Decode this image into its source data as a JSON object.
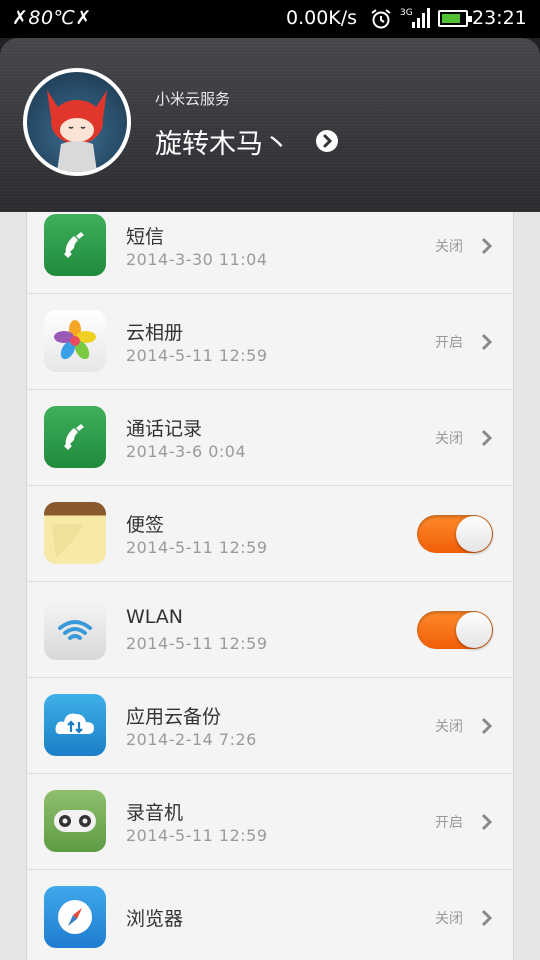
{
  "status_bar": {
    "left": "✗80℃✗",
    "speed": "0.00K/s",
    "time": "23:21",
    "icons": [
      "alarm-icon",
      "signal-3g-icon",
      "battery-icon"
    ],
    "battery_color": "#52c234"
  },
  "header": {
    "service_label": "小米云服务",
    "user_name": "旋转木马丶"
  },
  "colors": {
    "toggle_on": "#f05e08",
    "list_bg": "#f4f4f4"
  },
  "items": [
    {
      "icon": "phone-icon",
      "title": "短信",
      "date": "2014-3-30 11:04",
      "status": "关闭",
      "control": "chevron"
    },
    {
      "icon": "photos-flower-icon",
      "title": "云相册",
      "date": "2014-5-11 12:59",
      "status": "开启",
      "control": "chevron"
    },
    {
      "icon": "phone-icon",
      "title": "通话记录",
      "date": "2014-3-6 0:04",
      "status": "关闭",
      "control": "chevron"
    },
    {
      "icon": "notes-icon",
      "title": "便签",
      "date": "2014-5-11 12:59",
      "status": "",
      "control": "toggle-on"
    },
    {
      "icon": "wifi-icon",
      "title": "WLAN",
      "date": "2014-5-11 12:59",
      "status": "",
      "control": "toggle-on"
    },
    {
      "icon": "cloud-backup-icon",
      "title": "应用云备份",
      "date": "2014-2-14 7:26",
      "status": "关闭",
      "control": "chevron"
    },
    {
      "icon": "recorder-icon",
      "title": "录音机",
      "date": "2014-5-11 12:59",
      "status": "开启",
      "control": "chevron"
    },
    {
      "icon": "compass-browser-icon",
      "title": "浏览器",
      "date": "",
      "status": "关闭",
      "control": "chevron"
    }
  ]
}
